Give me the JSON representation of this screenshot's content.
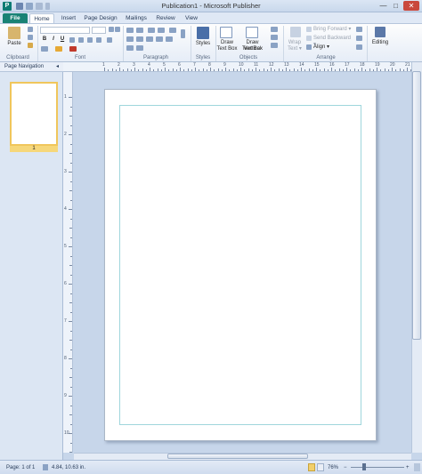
{
  "app": {
    "logo_letter": "P",
    "window_title": "Publication1 - Microsoft Publisher",
    "accent": "#198275"
  },
  "window_controls": {
    "minimize": "—",
    "maximize": "□",
    "close": "✕"
  },
  "tabs": [
    {
      "label": "File"
    },
    {
      "label": "Home"
    },
    {
      "label": "Insert"
    },
    {
      "label": "Page Design"
    },
    {
      "label": "Mailings"
    },
    {
      "label": "Review"
    },
    {
      "label": "View"
    }
  ],
  "ribbon": {
    "clipboard": {
      "paste_label": "Paste",
      "group_label": "Clipboard"
    },
    "font": {
      "group_label": "Font",
      "bold": "B",
      "italic": "I",
      "underline": "U"
    },
    "paragraph": {
      "group_label": "Paragraph"
    },
    "styles": {
      "styles_label": "Styles",
      "group_label": "Styles"
    },
    "objects": {
      "draw_text_box_line1": "Draw",
      "draw_text_box_line2": "Text Box",
      "draw_vertical_line1": "Draw Vertical",
      "draw_vertical_line2": "Text Box",
      "wrap_text_line1": "Wrap",
      "wrap_text_line2": "Text ▾",
      "group_label": "Objects"
    },
    "arrange": {
      "bring_forward": "Bring Forward ▾",
      "send_backward": "Send Backward ▾",
      "align": "Align ▾",
      "group_label": "Arrange"
    },
    "editing": {
      "label": "Editing"
    }
  },
  "nav_panel": {
    "title": "Page Navigation",
    "collapse_glyph": "◂",
    "pages": [
      {
        "number": "1"
      }
    ]
  },
  "rulers": {
    "top_labels": [
      "1",
      "2",
      "3",
      "4",
      "5",
      "6",
      "7",
      "8",
      "9",
      "10",
      "11",
      "12",
      "13",
      "14",
      "15",
      "16",
      "17",
      "18",
      "19",
      "20",
      "21"
    ],
    "left_labels": [
      "1",
      "2",
      "3",
      "4",
      "5",
      "6",
      "7",
      "8",
      "9",
      "10"
    ]
  },
  "status": {
    "page": "Page: 1 of 1",
    "position": "4.84, 10.63 in.",
    "zoom": "76%",
    "zoom_minus": "−",
    "zoom_plus": "+"
  }
}
